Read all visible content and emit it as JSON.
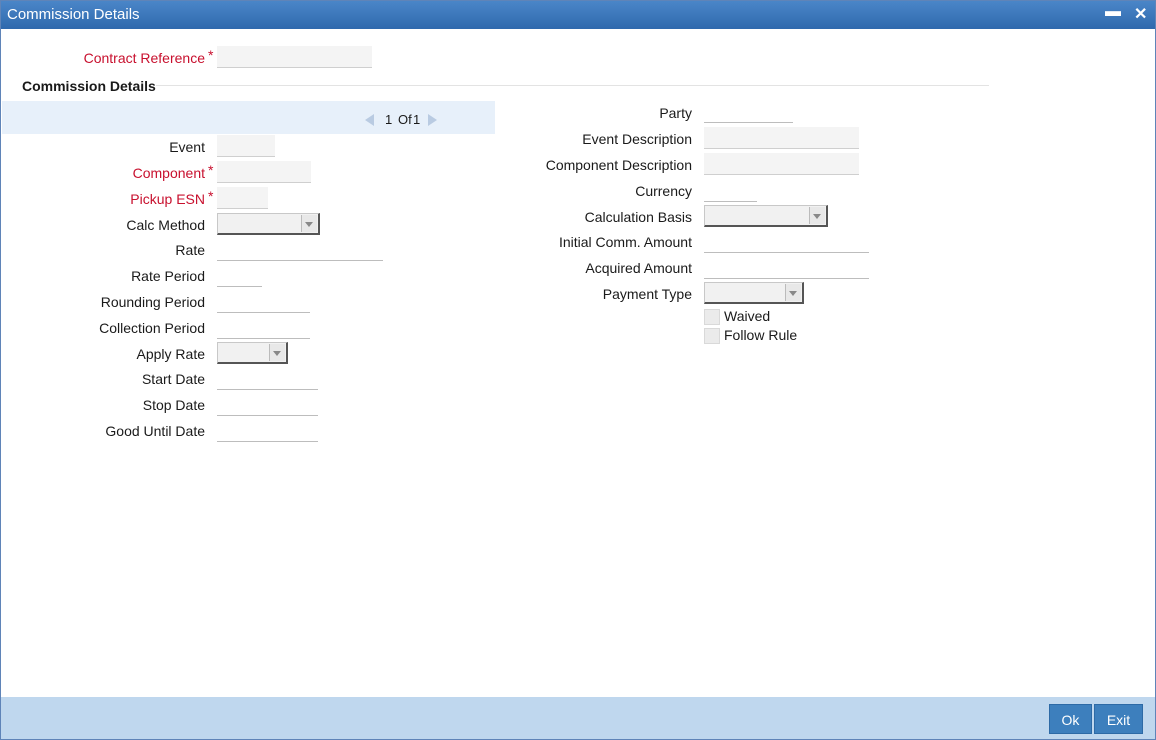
{
  "window": {
    "title": "Commission Details",
    "minimize_glyph": "▬",
    "close_glyph": "✕"
  },
  "header": {
    "contract_reference_label": "Contract Reference",
    "required_mark": "*"
  },
  "section": {
    "title": "Commission Details"
  },
  "pager": {
    "current": "1",
    "of_label": "Of",
    "total": "1"
  },
  "left": {
    "event_label": "Event",
    "component_label": "Component",
    "pickup_esn_label": "Pickup ESN",
    "calc_method_label": "Calc Method",
    "rate_label": "Rate",
    "rate_period_label": "Rate Period",
    "rounding_period_label": "Rounding Period",
    "collection_period_label": "Collection Period",
    "apply_rate_label": "Apply Rate",
    "start_date_label": "Start Date",
    "stop_date_label": "Stop Date",
    "good_until_date_label": "Good Until Date"
  },
  "right": {
    "party_label": "Party",
    "event_description_label": "Event Description",
    "component_description_label": "Component Description",
    "currency_label": "Currency",
    "calculation_basis_label": "Calculation Basis",
    "initial_comm_amount_label": "Initial Comm. Amount",
    "acquired_amount_label": "Acquired Amount",
    "payment_type_label": "Payment Type",
    "waived_label": "Waived",
    "follow_rule_label": "Follow Rule"
  },
  "footer": {
    "ok_label": "Ok",
    "exit_label": "Exit"
  },
  "colors": {
    "titlebar": "#2f69ad",
    "required": "#c8102e",
    "footer": "#bfd7ee",
    "button": "#3d7fbd"
  }
}
